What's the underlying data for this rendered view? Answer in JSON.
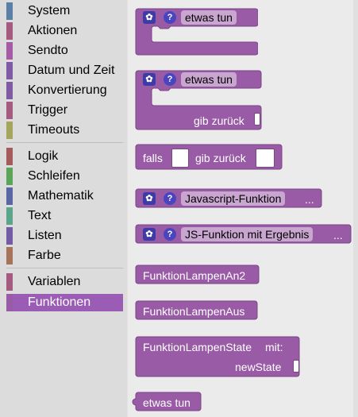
{
  "toolbox": {
    "categories": [
      {
        "label": "System",
        "color": "#5b80a5"
      },
      {
        "label": "Aktionen",
        "color": "#a55b80"
      },
      {
        "label": "Sendto",
        "color": "#a55ba5"
      },
      {
        "label": "Datum und Zeit",
        "color": "#805ba5"
      },
      {
        "label": "Konvertierung",
        "color": "#805ba5"
      },
      {
        "label": "Trigger",
        "color": "#a55b80"
      },
      {
        "label": "Timeouts",
        "color": "#a5a55b"
      },
      {
        "label": "Logik",
        "color": "#a55b5b"
      },
      {
        "label": "Schleifen",
        "color": "#5ba55b"
      },
      {
        "label": "Mathematik",
        "color": "#5b67a5"
      },
      {
        "label": "Text",
        "color": "#5ba58c"
      },
      {
        "label": "Listen",
        "color": "#745ba5"
      },
      {
        "label": "Farbe",
        "color": "#a5745b"
      },
      {
        "label": "Variablen",
        "color": "#a55b80"
      },
      {
        "label": "Funktionen",
        "color": "#995ba5",
        "selected": true
      }
    ]
  },
  "flyout": {
    "block_color": "#995ba5",
    "blocks": {
      "proc_no_return": {
        "name": "etwas tun"
      },
      "proc_return": {
        "name": "etwas tun",
        "return_label": "gib zurück"
      },
      "if_return": {
        "if_label": "falls",
        "return_label": "gib zurück"
      },
      "js_func": {
        "name": "Javascript-Funktion",
        "more": "..."
      },
      "js_func_result": {
        "name": "JS-Funktion mit Ergebnis",
        "more": "..."
      },
      "call1": {
        "label": "FunktionLampenAn2"
      },
      "call2": {
        "label": "FunktionLampenAus"
      },
      "call3": {
        "label": "FunktionLampenState",
        "with_label": "mit:",
        "param": "newState"
      },
      "call4": {
        "label": "etwas tun"
      }
    }
  }
}
